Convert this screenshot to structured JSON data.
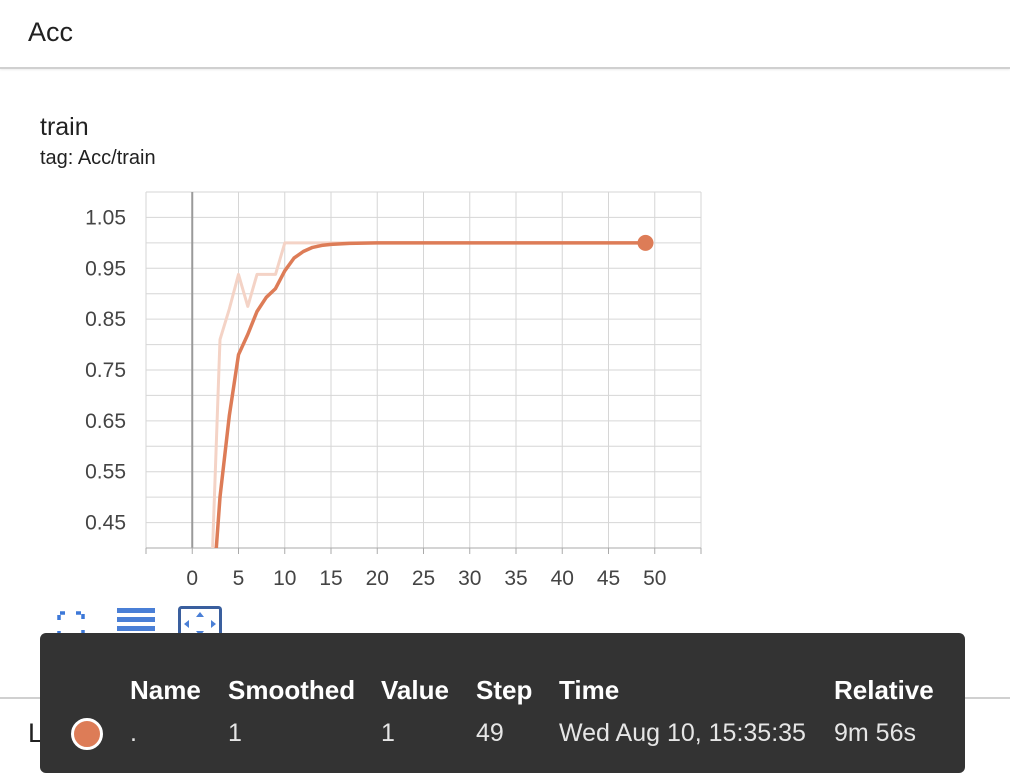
{
  "section_title": "Acc",
  "card": {
    "title": "train",
    "tag": "tag: Acc/train"
  },
  "chart_data": {
    "type": "line",
    "xlim": [
      -5,
      55
    ],
    "ylim": [
      0.4,
      1.1
    ],
    "x_ticks": [
      0,
      5,
      10,
      15,
      20,
      25,
      30,
      35,
      40,
      45,
      50
    ],
    "y_ticks": [
      0.45,
      0.55,
      0.65,
      0.75,
      0.85,
      0.95,
      1.05
    ],
    "y_tick_labels": [
      "0.45",
      "0.55",
      "0.65",
      "0.75",
      "0.85",
      "0.95",
      "1.05"
    ],
    "grid": true,
    "series": [
      {
        "style": "raw",
        "color": "#f4d3c6",
        "x": [
          2,
          3,
          4,
          5,
          6,
          7,
          8,
          9,
          10,
          11,
          12,
          15,
          20,
          25,
          30,
          35,
          40,
          45,
          49
        ],
        "y": [
          0.3,
          0.81,
          0.87,
          0.938,
          0.875,
          0.938,
          0.938,
          0.938,
          1.0,
          1.0,
          1.0,
          1.0,
          1.0,
          1.0,
          1.0,
          1.0,
          1.0,
          1.0,
          1.0
        ]
      },
      {
        "style": "smoothed",
        "color": "#dd7c57",
        "x": [
          2.6,
          3,
          4,
          5,
          6,
          7,
          8,
          9,
          10,
          11,
          12,
          13,
          14,
          15,
          17,
          20,
          25,
          30,
          35,
          40,
          45,
          49
        ],
        "y": [
          0.4,
          0.5,
          0.66,
          0.78,
          0.82,
          0.865,
          0.893,
          0.91,
          0.945,
          0.97,
          0.983,
          0.991,
          0.995,
          0.997,
          0.999,
          1.0,
          1.0,
          1.0,
          1.0,
          1.0,
          1.0,
          1.0
        ]
      }
    ],
    "highlight_point": {
      "x": 49,
      "y": 1.0
    }
  },
  "toolbar": {
    "fullscreen_icon": "fullscreen-icon",
    "legend_icon": "list-icon",
    "fit_icon": "fit-domain-icon"
  },
  "loss_section_title": "Loss",
  "tooltip": {
    "headers": {
      "name": "Name",
      "smoothed": "Smoothed",
      "value": "Value",
      "step": "Step",
      "time": "Time",
      "relative": "Relative"
    },
    "row": {
      "swatch_color": "#dd7c57",
      "name": ".",
      "smoothed": "1",
      "value": "1",
      "step": "49",
      "time": "Wed Aug 10, 15:35:35",
      "relative": "9m 56s"
    }
  }
}
